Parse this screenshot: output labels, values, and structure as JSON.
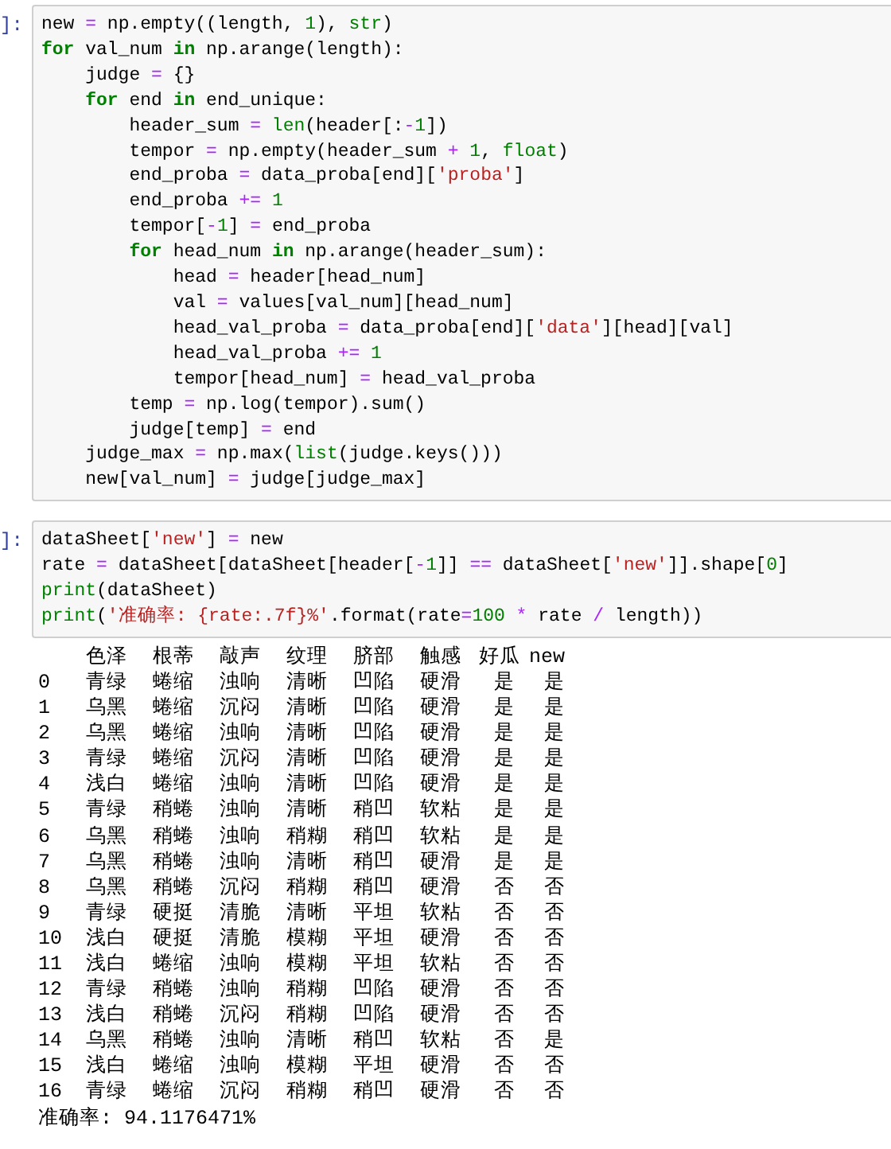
{
  "cells": [
    {
      "prompt": "]:",
      "lines": [
        [
          "new ",
          {
            "kind": "op",
            "text": "="
          },
          " np.empty((length, ",
          {
            "kind": "num",
            "text": "1"
          },
          "), ",
          {
            "kind": "builtin",
            "text": "str"
          },
          ")"
        ],
        [
          {
            "kind": "keyword",
            "text": "for"
          },
          " val_num ",
          {
            "kind": "keyword",
            "text": "in"
          },
          " np.arange(length):"
        ],
        [
          "    judge ",
          {
            "kind": "op",
            "text": "="
          },
          " {}"
        ],
        [
          {
            "kind": "keyword",
            "text": "    for"
          },
          " end ",
          {
            "kind": "keyword",
            "text": "in"
          },
          " end_unique:"
        ],
        [
          "        header_sum ",
          {
            "kind": "op",
            "text": "="
          },
          {
            "kind": "builtin",
            "text": " len"
          },
          "(header[:",
          {
            "kind": "op",
            "text": "-"
          },
          {
            "kind": "num",
            "text": "1"
          },
          "])"
        ],
        [
          "        tempor ",
          {
            "kind": "op",
            "text": "="
          },
          " np.empty(header_sum ",
          {
            "kind": "op",
            "text": "+"
          },
          {
            "kind": "num",
            "text": " 1"
          },
          ", ",
          {
            "kind": "builtin",
            "text": "float"
          },
          ")"
        ],
        [
          "        end_proba ",
          {
            "kind": "op",
            "text": "="
          },
          " data_proba[end][",
          {
            "kind": "str",
            "text": "'proba'"
          },
          "]"
        ],
        [
          "        end_proba ",
          {
            "kind": "op",
            "text": "+="
          },
          {
            "kind": "num",
            "text": " 1"
          }
        ],
        [
          "        tempor[",
          {
            "kind": "op",
            "text": "-"
          },
          {
            "kind": "num",
            "text": "1"
          },
          "] ",
          {
            "kind": "op",
            "text": "="
          },
          " end_proba"
        ],
        [
          {
            "kind": "keyword",
            "text": "        for"
          },
          " head_num ",
          {
            "kind": "keyword",
            "text": "in"
          },
          " np.arange(header_sum):"
        ],
        [
          "            head ",
          {
            "kind": "op",
            "text": "="
          },
          " header[head_num]"
        ],
        [
          "            val ",
          {
            "kind": "op",
            "text": "="
          },
          " values[val_num][head_num]"
        ],
        [
          "            head_val_proba ",
          {
            "kind": "op",
            "text": "="
          },
          " data_proba[end][",
          {
            "kind": "str",
            "text": "'data'"
          },
          "][head][val]"
        ],
        [
          "            head_val_proba ",
          {
            "kind": "op",
            "text": "+="
          },
          {
            "kind": "num",
            "text": " 1"
          }
        ],
        [
          "            tempor[head_num] ",
          {
            "kind": "op",
            "text": "="
          },
          " head_val_proba"
        ],
        [
          "        temp ",
          {
            "kind": "op",
            "text": "="
          },
          " np.log(tempor).sum()"
        ],
        [
          "        judge[temp] ",
          {
            "kind": "op",
            "text": "="
          },
          " end"
        ],
        [
          "    judge_max ",
          {
            "kind": "op",
            "text": "="
          },
          " np.max(",
          {
            "kind": "builtin",
            "text": "list"
          },
          "(judge.keys()))"
        ],
        [
          "    new[val_num] ",
          {
            "kind": "op",
            "text": "="
          },
          " judge[judge_max]"
        ]
      ]
    },
    {
      "prompt": "]:",
      "lines": [
        [
          "dataSheet[",
          {
            "kind": "str",
            "text": "'new'"
          },
          "] ",
          {
            "kind": "op",
            "text": "="
          },
          " new"
        ],
        [
          "rate ",
          {
            "kind": "op",
            "text": "="
          },
          " dataSheet[dataSheet[header[",
          {
            "kind": "op",
            "text": "-"
          },
          {
            "kind": "num",
            "text": "1"
          },
          "]] ",
          {
            "kind": "op",
            "text": "=="
          },
          " dataSheet[",
          {
            "kind": "str",
            "text": "'new'"
          },
          "]].shape[",
          {
            "kind": "num",
            "text": "0"
          },
          "]"
        ],
        [
          {
            "kind": "builtin",
            "text": "print"
          },
          "(dataSheet)"
        ],
        [
          {
            "kind": "builtin",
            "text": "print"
          },
          "(",
          {
            "kind": "str",
            "text": "'准确率: {rate:.7f}%'"
          },
          ".format(rate",
          {
            "kind": "op",
            "text": "="
          },
          {
            "kind": "num",
            "text": "100"
          },
          {
            "kind": "op",
            "text": " *"
          },
          " rate ",
          {
            "kind": "op",
            "text": "/"
          },
          " length))"
        ]
      ],
      "output": {
        "columns": [
          "色泽",
          "根蒂",
          "敲声",
          "纹理",
          "脐部",
          "触感",
          "好瓜",
          "new"
        ],
        "rows": [
          {
            "index": "0",
            "cells": [
              "青绿",
              "蜷缩",
              "浊响",
              "清晰",
              "凹陷",
              "硬滑",
              "是",
              "是"
            ]
          },
          {
            "index": "1",
            "cells": [
              "乌黑",
              "蜷缩",
              "沉闷",
              "清晰",
              "凹陷",
              "硬滑",
              "是",
              "是"
            ]
          },
          {
            "index": "2",
            "cells": [
              "乌黑",
              "蜷缩",
              "浊响",
              "清晰",
              "凹陷",
              "硬滑",
              "是",
              "是"
            ]
          },
          {
            "index": "3",
            "cells": [
              "青绿",
              "蜷缩",
              "沉闷",
              "清晰",
              "凹陷",
              "硬滑",
              "是",
              "是"
            ]
          },
          {
            "index": "4",
            "cells": [
              "浅白",
              "蜷缩",
              "浊响",
              "清晰",
              "凹陷",
              "硬滑",
              "是",
              "是"
            ]
          },
          {
            "index": "5",
            "cells": [
              "青绿",
              "稍蜷",
              "浊响",
              "清晰",
              "稍凹",
              "软粘",
              "是",
              "是"
            ]
          },
          {
            "index": "6",
            "cells": [
              "乌黑",
              "稍蜷",
              "浊响",
              "稍糊",
              "稍凹",
              "软粘",
              "是",
              "是"
            ]
          },
          {
            "index": "7",
            "cells": [
              "乌黑",
              "稍蜷",
              "浊响",
              "清晰",
              "稍凹",
              "硬滑",
              "是",
              "是"
            ]
          },
          {
            "index": "8",
            "cells": [
              "乌黑",
              "稍蜷",
              "沉闷",
              "稍糊",
              "稍凹",
              "硬滑",
              "否",
              "否"
            ]
          },
          {
            "index": "9",
            "cells": [
              "青绿",
              "硬挺",
              "清脆",
              "清晰",
              "平坦",
              "软粘",
              "否",
              "否"
            ]
          },
          {
            "index": "10",
            "cells": [
              "浅白",
              "硬挺",
              "清脆",
              "模糊",
              "平坦",
              "硬滑",
              "否",
              "否"
            ]
          },
          {
            "index": "11",
            "cells": [
              "浅白",
              "蜷缩",
              "浊响",
              "模糊",
              "平坦",
              "软粘",
              "否",
              "否"
            ]
          },
          {
            "index": "12",
            "cells": [
              "青绿",
              "稍蜷",
              "浊响",
              "稍糊",
              "凹陷",
              "硬滑",
              "否",
              "否"
            ]
          },
          {
            "index": "13",
            "cells": [
              "浅白",
              "稍蜷",
              "沉闷",
              "稍糊",
              "凹陷",
              "硬滑",
              "否",
              "否"
            ]
          },
          {
            "index": "14",
            "cells": [
              "乌黑",
              "稍蜷",
              "浊响",
              "清晰",
              "稍凹",
              "软粘",
              "否",
              "是"
            ]
          },
          {
            "index": "15",
            "cells": [
              "浅白",
              "蜷缩",
              "浊响",
              "模糊",
              "平坦",
              "硬滑",
              "否",
              "否"
            ]
          },
          {
            "index": "16",
            "cells": [
              "青绿",
              "蜷缩",
              "沉闷",
              "稍糊",
              "稍凹",
              "硬滑",
              "否",
              "否"
            ]
          }
        ],
        "footer": "准确率: 94.1176471%"
      }
    }
  ]
}
